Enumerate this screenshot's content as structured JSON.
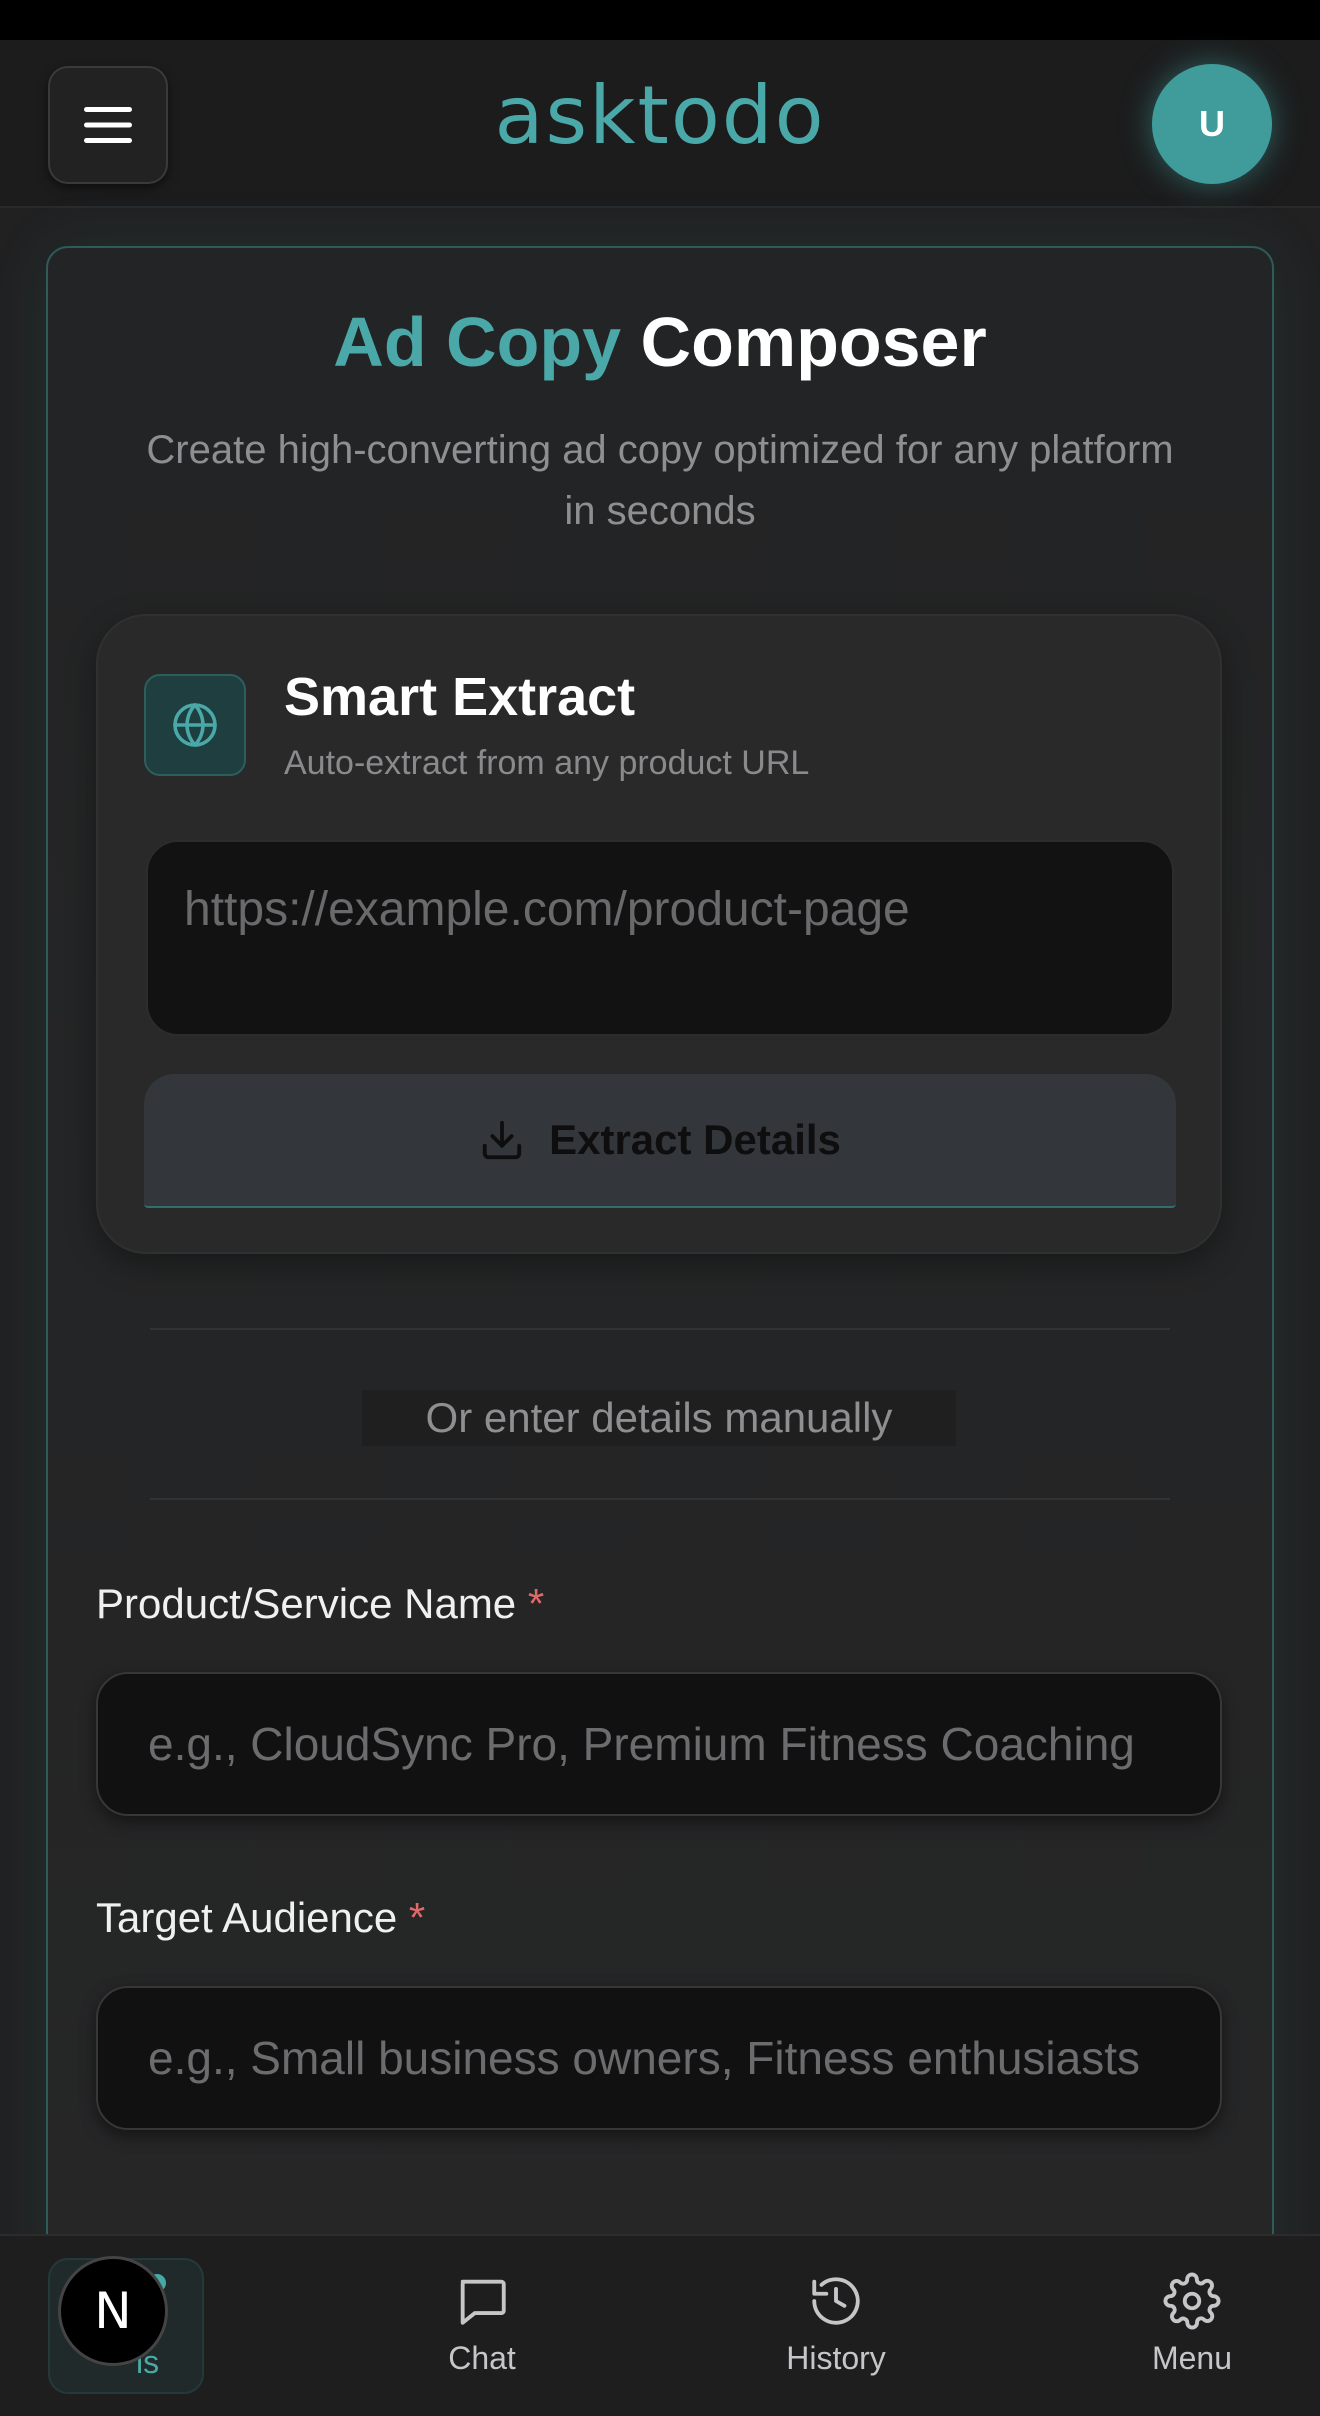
{
  "header": {
    "logo": "asktodo",
    "avatar_initial": "U"
  },
  "hero": {
    "title_highlight": "Ad Copy",
    "title_rest": "Composer",
    "subtitle": "Create high-converting ad copy optimized for any platform in seconds"
  },
  "smart_extract": {
    "icon": "globe-icon",
    "title": "Smart Extract",
    "subtitle": "Auto-extract from any product URL",
    "url_placeholder": "https://example.com/product-page",
    "button_label": "Extract Details",
    "button_icon": "download-icon"
  },
  "manual_divider": "Or enter details manually",
  "form": {
    "product_name": {
      "label": "Product/Service Name",
      "required_mark": "*",
      "placeholder": "e.g., CloudSync Pro, Premium Fitness Coaching"
    },
    "target_audience": {
      "label": "Target Audience",
      "required_mark": "*",
      "placeholder": "e.g., Small business owners, Fitness enthusiasts"
    }
  },
  "bottom_nav": {
    "first_partial_label": "ls",
    "badge_letter": "N",
    "items": [
      {
        "label": "Chat",
        "icon": "chat-bubble-icon"
      },
      {
        "label": "History",
        "icon": "history-icon"
      },
      {
        "label": "Menu",
        "icon": "gear-icon"
      }
    ]
  },
  "colors": {
    "accent": "#4aa9a8",
    "required": "#e06a6a",
    "background": "#212122"
  }
}
